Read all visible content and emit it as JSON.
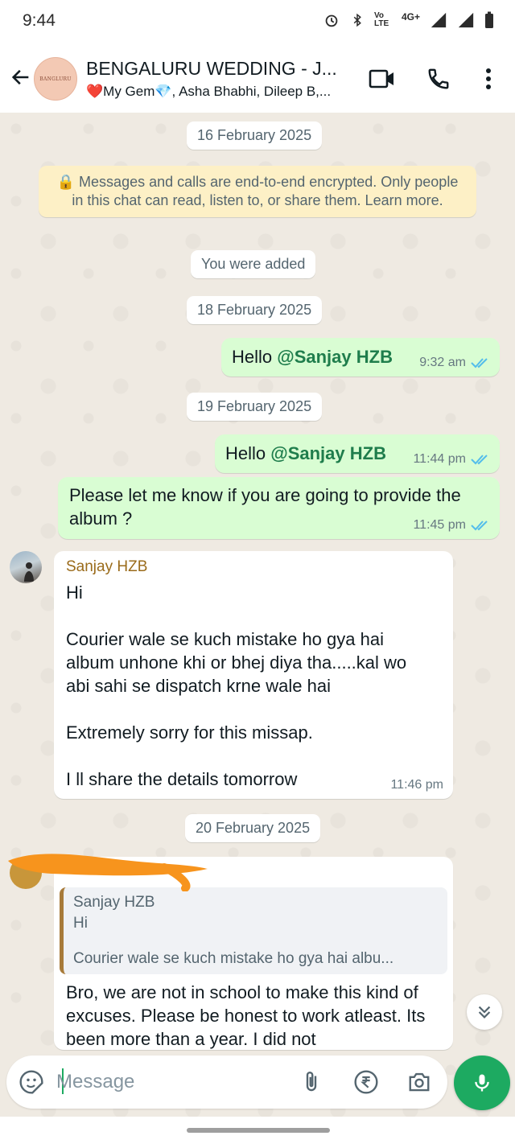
{
  "status_bar": {
    "time": "9:44",
    "network_label": "Vo LTE",
    "network_type": "4G+"
  },
  "header": {
    "title": "BENGALURU WEDDING - J...",
    "subtitle": "❤️My Gem💎, Asha Bhabhi, Dileep B,...",
    "avatar_text": "BANGLURU"
  },
  "chat": {
    "notice": "🔒 Messages and calls are end-to-end encrypted. Only people in this chat can read, listen to, or share them. Learn more.",
    "system_added": "You were added",
    "dates": [
      "16 February 2025",
      "18 February 2025",
      "19 February 2025",
      "20 February 2025"
    ],
    "messages": [
      {
        "greeting": "Hello ",
        "mention": "@Sanjay HZB",
        "time": "9:32 am"
      },
      {
        "greeting": "Hello ",
        "mention": "@Sanjay HZB",
        "time": "11:44 pm"
      },
      {
        "text": "Please let me know if you are going to provide the album ?",
        "time": "11:45 pm"
      },
      {
        "sender": "Sanjay HZB",
        "line1": "Hi",
        "line2": "Courier wale se kuch mistake ho gya hai album unhone khi or bhej diya tha.....kal wo abi sahi se dispatch krne wale hai",
        "line3": "Extremely sorry for this missap.",
        "line4": "I ll share the details tomorrow",
        "time": "11:46 pm"
      },
      {
        "quote_name": "Sanjay HZB",
        "quote_line1": "Hi",
        "quote_line2": "Courier wale se kuch mistake ho gya hai albu...",
        "text": "Bro, we are not in school to make this kind of excuses. Please be honest to work atleast. Its been more than a year. I did not"
      }
    ]
  },
  "input": {
    "placeholder": "Message"
  },
  "colors": {
    "outgoing_bubble": "#d9fdd3",
    "incoming_bubble": "#ffffff",
    "accent_green": "#1daa61",
    "mention_green": "#1f7d4c",
    "read_ticks": "#53bdeb",
    "redaction": "#f7941d"
  },
  "icons": [
    "back-arrow-icon",
    "video-call-icon",
    "phone-icon",
    "more-options-icon",
    "double-check-icon",
    "chevron-double-down-icon",
    "sticker-icon",
    "attach-icon",
    "rupee-icon",
    "camera-icon",
    "mic-icon"
  ]
}
